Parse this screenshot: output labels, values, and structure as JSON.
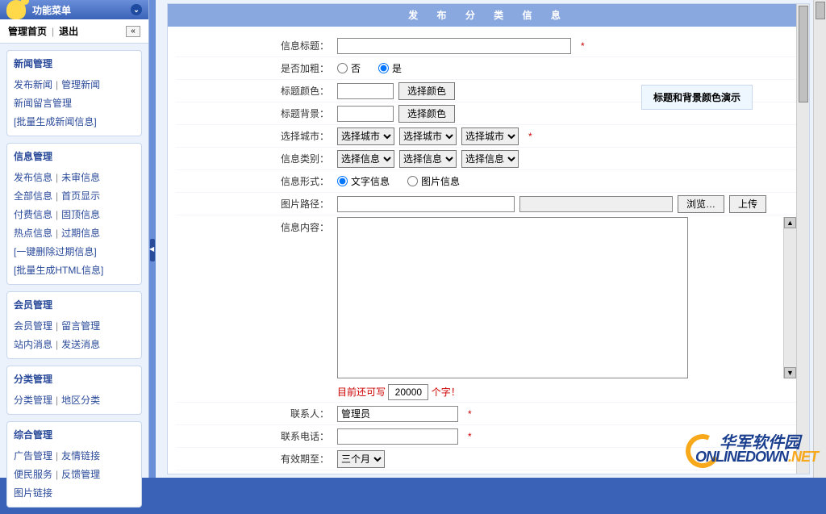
{
  "sidebar": {
    "menu_title": "功能菜单",
    "nav_home": "管理首页",
    "nav_logout": "退出",
    "groups": [
      {
        "title": "新闻管理",
        "items": [
          [
            "发布新闻",
            "管理新闻"
          ],
          [
            "新闻留言管理"
          ],
          [
            "[批量生成新闻信息]"
          ]
        ]
      },
      {
        "title": "信息管理",
        "items": [
          [
            "发布信息",
            "未审信息"
          ],
          [
            "全部信息",
            "首页显示"
          ],
          [
            "付费信息",
            "固顶信息"
          ],
          [
            "热点信息",
            "过期信息"
          ],
          [
            "[一键删除过期信息]"
          ],
          [
            "[批量生成HTML信息]"
          ]
        ]
      },
      {
        "title": "会员管理",
        "items": [
          [
            "会员管理",
            "留言管理"
          ],
          [
            "站内消息",
            "发送消息"
          ]
        ]
      },
      {
        "title": "分类管理",
        "items": [
          [
            "分类管理",
            "地区分类"
          ]
        ]
      },
      {
        "title": "综合管理",
        "items": [
          [
            "广告管理",
            "友情链接"
          ],
          [
            "便民服务",
            "反馈管理"
          ],
          [
            "图片链接"
          ]
        ]
      }
    ]
  },
  "page_title": "发 布 分 类 信 息",
  "labels": {
    "title": "信息标题：",
    "bold": "是否加粗：",
    "bold_no": "否",
    "bold_yes": "是",
    "title_color": "标题颜色：",
    "title_bg": "标题背景：",
    "choose_color": "选择颜色",
    "city": "选择城市：",
    "city_opt": "选择城市",
    "category": "信息类别：",
    "cat_opt": "选择信息",
    "form": "信息形式：",
    "form_text": "文字信息",
    "form_img": "图片信息",
    "img_path": "图片路径：",
    "browse": "浏览…",
    "upload": "上传",
    "content": "信息内容：",
    "char_left_pre": "目前还可写",
    "char_left_val": "20000",
    "char_left_post": "个字！",
    "contact": "联系人：",
    "contact_val": "管理员",
    "phone": "联系电话：",
    "period": "有效期至：",
    "period_opt": "三个月",
    "demo": "标题和背景颜色演示"
  },
  "watermark": {
    "cn": "华军软件园",
    "en": "ONLINEDOWN",
    "net": ".NET"
  }
}
